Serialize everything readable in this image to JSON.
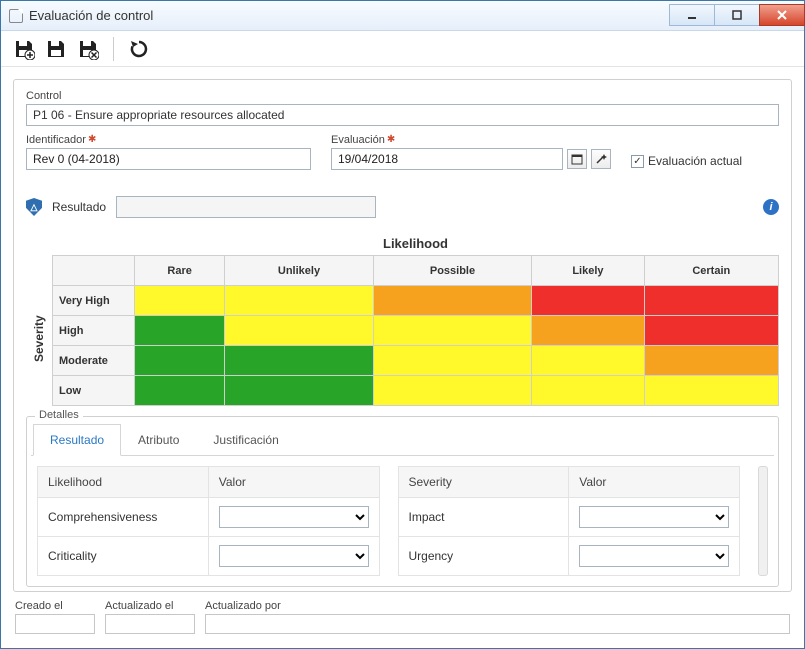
{
  "window": {
    "title": "Evaluación de control"
  },
  "toolbar": {
    "add_icon": "save-add",
    "save_icon": "save",
    "delete_icon": "save-delete",
    "refresh_icon": "refresh"
  },
  "labels": {
    "control": "Control",
    "identificador": "Identificador",
    "evaluacion": "Evaluación",
    "evaluacion_actual": "Evaluación actual",
    "resultado": "Resultado",
    "likelihood": "Likelihood",
    "severity": "Severity",
    "detalles": "Detalles",
    "valor": "Valor",
    "creado_el": "Creado el",
    "actualizado_el": "Actualizado el",
    "actualizado_por": "Actualizado por"
  },
  "fields": {
    "control": "P1 06 - Ensure appropriate resources allocated",
    "identificador": "Rev 0 (04-2018)",
    "evaluacion": "19/04/2018",
    "evaluacion_actual_checked": true,
    "resultado": "",
    "creado_el": "",
    "actualizado_el": "",
    "actualizado_por": ""
  },
  "matrix": {
    "col_headers": [
      "Rare",
      "Unlikely",
      "Possible",
      "Likely",
      "Certain"
    ],
    "row_headers": [
      "Very High",
      "High",
      "Moderate",
      "Low"
    ],
    "cells": [
      [
        "y",
        "y",
        "o",
        "r",
        "r"
      ],
      [
        "g",
        "y",
        "y",
        "o",
        "r"
      ],
      [
        "g",
        "g",
        "y",
        "y",
        "o"
      ],
      [
        "g",
        "g",
        "y",
        "y",
        "y"
      ]
    ]
  },
  "chart_data": {
    "type": "heatmap",
    "title": "Likelihood",
    "xlabel": "Likelihood",
    "ylabel": "Severity",
    "x_categories": [
      "Rare",
      "Unlikely",
      "Possible",
      "Likely",
      "Certain"
    ],
    "y_categories": [
      "Very High",
      "High",
      "Moderate",
      "Low"
    ],
    "values": [
      [
        "yellow",
        "yellow",
        "orange",
        "red",
        "red"
      ],
      [
        "green",
        "yellow",
        "yellow",
        "orange",
        "red"
      ],
      [
        "green",
        "green",
        "yellow",
        "yellow",
        "orange"
      ],
      [
        "green",
        "green",
        "yellow",
        "yellow",
        "yellow"
      ]
    ],
    "color_legend": {
      "green": "#28a528",
      "yellow": "#fff92b",
      "orange": "#f6a21f",
      "red": "#ef2f2c"
    }
  },
  "tabs": {
    "active": 0,
    "items": [
      "Resultado",
      "Atributo",
      "Justificación"
    ]
  },
  "detail": {
    "left": {
      "header": "Likelihood",
      "rows": [
        {
          "label": "Comprehensiveness",
          "value": ""
        },
        {
          "label": "Criticality",
          "value": ""
        }
      ]
    },
    "right": {
      "header": "Severity",
      "rows": [
        {
          "label": "Impact",
          "value": ""
        },
        {
          "label": "Urgency",
          "value": ""
        }
      ]
    }
  }
}
